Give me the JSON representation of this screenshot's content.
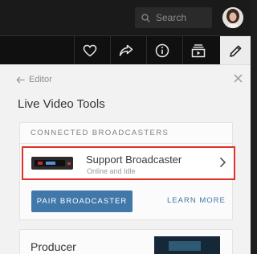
{
  "header": {
    "search": {
      "placeholder": "Search",
      "icon": "search-icon"
    },
    "avatar": "user-avatar"
  },
  "toolbar": {
    "buttons": [
      "heart-icon",
      "share-icon",
      "info-icon",
      "media-icon",
      "pencil-icon"
    ],
    "active": "pencil-icon"
  },
  "panel": {
    "breadcrumb": "Editor",
    "title": "Live Video Tools",
    "connected": {
      "heading": "CONNECTED BROADCASTERS",
      "broadcaster": {
        "name": "Support Broadcaster",
        "status": "Online and Idle"
      },
      "pair_label": "PAIR BROADCASTER",
      "learn_label": "LEARN MORE"
    },
    "producer": {
      "title": "Producer"
    }
  },
  "colors": {
    "accent": "#3f78a9",
    "highlight": "#e03228",
    "toolbar_bg": "#101010",
    "panel_bg": "#f2f2f2"
  }
}
